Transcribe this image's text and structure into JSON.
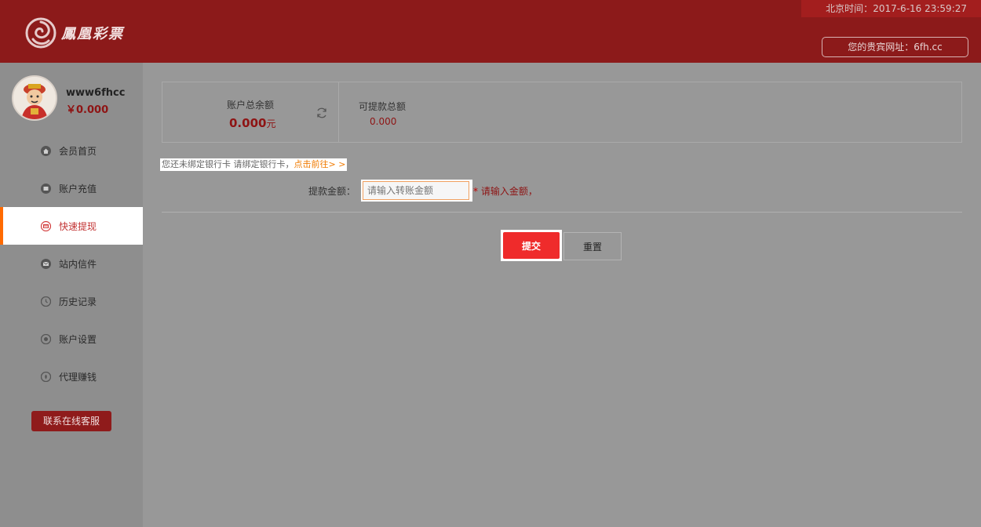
{
  "header": {
    "clock_label": "北京时间：",
    "clock_value": "2017-6-16 23:59:27",
    "logo_text": "鳳凰彩票",
    "site_url": "您的贵宾网址：6fh.cc"
  },
  "user": {
    "name": "www6fhcc",
    "balance": "￥0.000"
  },
  "sidebar": {
    "items": [
      {
        "label": "会员首页",
        "icon": "home-icon",
        "active": false
      },
      {
        "label": "账户充值",
        "icon": "wallet-icon",
        "active": false
      },
      {
        "label": "快速提现",
        "icon": "card-icon",
        "active": true
      },
      {
        "label": "站内信件",
        "icon": "mail-icon",
        "active": false
      },
      {
        "label": "历史记录",
        "icon": "clock-icon",
        "active": false
      },
      {
        "label": "账户设置",
        "icon": "gear-icon",
        "active": false
      },
      {
        "label": "代理赚钱",
        "icon": "coin-icon",
        "active": false
      }
    ],
    "support_button": "联系在线客服"
  },
  "summary": {
    "total_label": "账户总余额",
    "total_value": "0.000",
    "total_unit": "元",
    "withdrawable_label": "可提款总额",
    "withdrawable_value": "0.000"
  },
  "notice": {
    "text": "您还未绑定银行卡 请绑定银行卡，",
    "link": "点击前往> >"
  },
  "form": {
    "amount_label": "提款金额：",
    "amount_placeholder": "请输入转账金额",
    "amount_value": "",
    "required_mark": "*",
    "hint": " 请输入金额，",
    "submit_label": "提交",
    "reset_label": "重置"
  },
  "colors": {
    "brand_red": "#8c1a1a",
    "submit_red": "#ef2b2b",
    "active_accent": "#ff6a00",
    "link_orange": "#f07a00"
  }
}
